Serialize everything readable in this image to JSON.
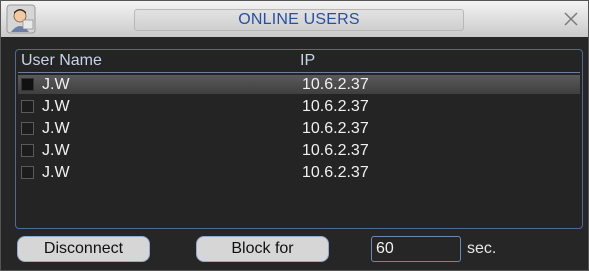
{
  "window": {
    "title": "ONLINE USERS"
  },
  "list": {
    "columns": [
      "User Name",
      "IP"
    ],
    "rows": [
      {
        "user": "J.W",
        "ip": "10.6.2.37",
        "selected": true
      },
      {
        "user": "J.W",
        "ip": "10.6.2.37",
        "selected": false
      },
      {
        "user": "J.W",
        "ip": "10.6.2.37",
        "selected": false
      },
      {
        "user": "J.W",
        "ip": "10.6.2.37",
        "selected": false
      },
      {
        "user": "J.W",
        "ip": "10.6.2.37",
        "selected": false
      }
    ]
  },
  "controls": {
    "disconnect_label": "Disconnect",
    "block_label": "Block for",
    "block_value": "60",
    "unit_label": "sec."
  },
  "icons": {
    "title": "user-avatar-icon",
    "close": "close-icon"
  },
  "colors": {
    "title_text": "#2a4fa0",
    "frame_border": "#4d6a9a"
  }
}
